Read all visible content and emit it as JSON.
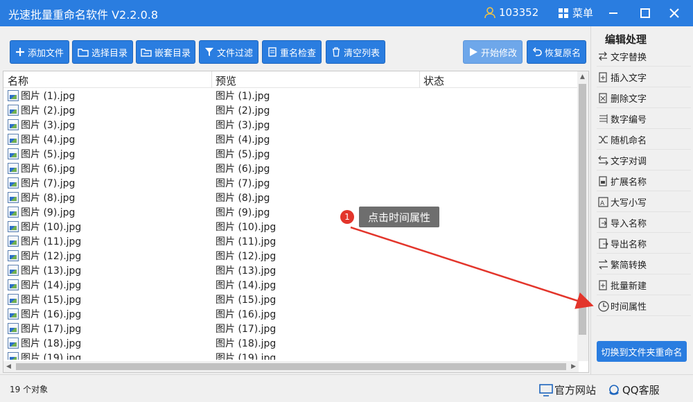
{
  "app": {
    "title": "光速批量重命名软件 V2.2.0.8",
    "user_id": "103352",
    "menu_label": "菜单"
  },
  "toolbar": {
    "add_file": "添加文件",
    "select_dir": "选择目录",
    "nested_dir": "嵌套目录",
    "file_filter": "文件过滤",
    "rename_check": "重名检查",
    "clear_list": "清空列表",
    "start_modify": "开始修改",
    "restore_name": "恢复原名"
  },
  "list": {
    "headers": [
      "名称",
      "预览",
      "状态"
    ],
    "rows": [
      {
        "name": "图片 (1).jpg",
        "preview": "图片 (1).jpg"
      },
      {
        "name": "图片 (2).jpg",
        "preview": "图片 (2).jpg"
      },
      {
        "name": "图片 (3).jpg",
        "preview": "图片 (3).jpg"
      },
      {
        "name": "图片 (4).jpg",
        "preview": "图片 (4).jpg"
      },
      {
        "name": "图片 (5).jpg",
        "preview": "图片 (5).jpg"
      },
      {
        "name": "图片 (6).jpg",
        "preview": "图片 (6).jpg"
      },
      {
        "name": "图片 (7).jpg",
        "preview": "图片 (7).jpg"
      },
      {
        "name": "图片 (8).jpg",
        "preview": "图片 (8).jpg"
      },
      {
        "name": "图片 (9).jpg",
        "preview": "图片 (9).jpg"
      },
      {
        "name": "图片 (10).jpg",
        "preview": "图片 (10).jpg"
      },
      {
        "name": "图片 (11).jpg",
        "preview": "图片 (11).jpg"
      },
      {
        "name": "图片 (12).jpg",
        "preview": "图片 (12).jpg"
      },
      {
        "name": "图片 (13).jpg",
        "preview": "图片 (13).jpg"
      },
      {
        "name": "图片 (14).jpg",
        "preview": "图片 (14).jpg"
      },
      {
        "name": "图片 (15).jpg",
        "preview": "图片 (15).jpg"
      },
      {
        "name": "图片 (16).jpg",
        "preview": "图片 (16).jpg"
      },
      {
        "name": "图片 (17).jpg",
        "preview": "图片 (17).jpg"
      },
      {
        "name": "图片 (18).jpg",
        "preview": "图片 (18).jpg"
      },
      {
        "name": "图片 (19).jpg",
        "preview": "图片 (19).jpg"
      }
    ]
  },
  "status": {
    "count": "19 个对象",
    "official_site": "官方网站",
    "qq_service": "QQ客服"
  },
  "panel": {
    "title": "编辑处理",
    "items": [
      {
        "label": "文字替换",
        "icon": "replace-icon"
      },
      {
        "label": "插入文字",
        "icon": "insert-icon"
      },
      {
        "label": "删除文字",
        "icon": "delete-icon"
      },
      {
        "label": "数字编号",
        "icon": "number-icon"
      },
      {
        "label": "随机命名",
        "icon": "shuffle-icon"
      },
      {
        "label": "文字对调",
        "icon": "swap-icon"
      },
      {
        "label": "扩展名称",
        "icon": "extension-icon"
      },
      {
        "label": "大写小写",
        "icon": "case-icon"
      },
      {
        "label": "导入名称",
        "icon": "import-icon"
      },
      {
        "label": "导出名称",
        "icon": "export-icon"
      },
      {
        "label": "繁简转换",
        "icon": "convert-icon"
      },
      {
        "label": "批量新建",
        "icon": "new-icon"
      },
      {
        "label": "时间属性",
        "icon": "clock-icon"
      }
    ],
    "switch_button": "切换到文件夹重命名"
  },
  "annotation": {
    "step": "1",
    "text": "点击时间属性"
  },
  "colors": {
    "primary": "#2a7de0",
    "annotation_arrow": "#e3352b"
  }
}
